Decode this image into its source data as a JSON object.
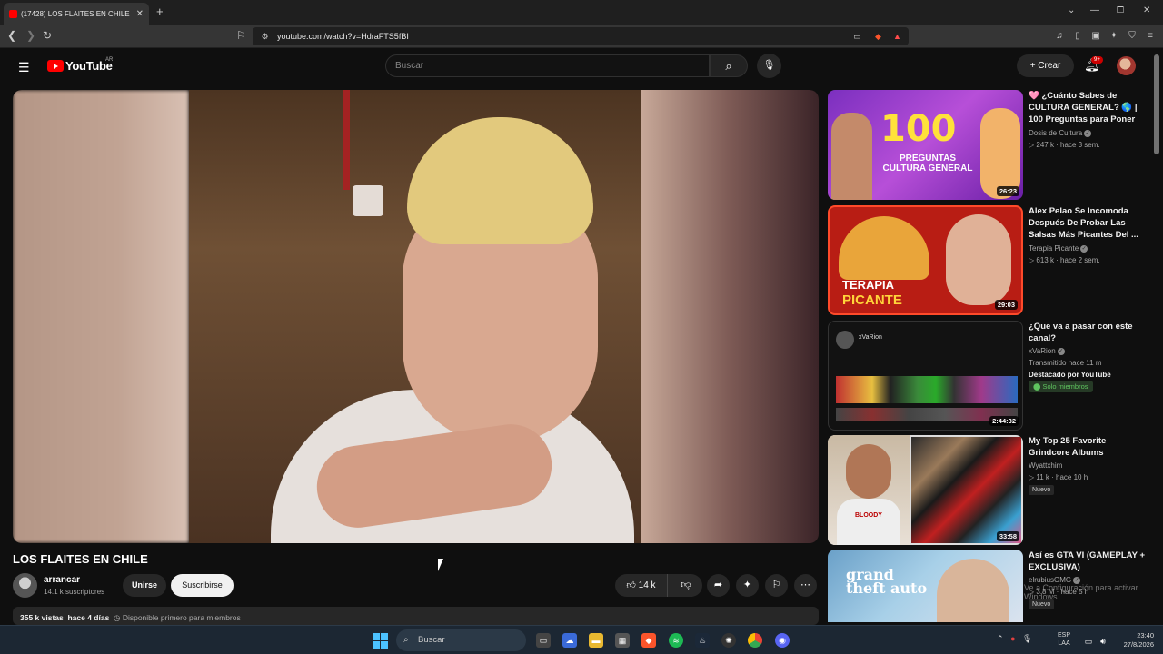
{
  "browser": {
    "tab_title": "(17428) LOS FLAITES EN CHILE",
    "tab_close": "✕",
    "new_tab": "+",
    "url": "youtube.com/watch?v=HdraFTS5fBI",
    "win_controls": [
      "⌄",
      "—",
      "⧠",
      "✕"
    ]
  },
  "header": {
    "logo_text": "YouTube",
    "country_code": "AR",
    "search_placeholder": "Buscar",
    "create_label": "+  Crear",
    "notif_badge": "9+"
  },
  "video": {
    "title": "LOS FLAITES EN CHILE",
    "channel": "arrancar",
    "subscribers": "14.1 k suscriptores",
    "join_label": "Unirse",
    "subscribe_label": "Suscribirse",
    "likes": "14 k",
    "views": "355 k vistas",
    "date": "hace 4 días",
    "members_note": "Disponible primero para miembros"
  },
  "recommendations": [
    {
      "title": "🩷 ¿Cuánto Sabes de CULTURA GENERAL? 🌎 | 100 Preguntas para Poner a...",
      "channel": "Dosis de Cultura",
      "meta": "▷ 247 k · hace 3 sem.",
      "duration": "26:23",
      "thumb_text": "100",
      "thumb_sub": "PREGUNTAS\nCULTURA GENERAL"
    },
    {
      "title": "Alex Pelao Se Incomoda Después De Probar Las Salsas Más Picantes Del ...",
      "channel": "Terapia Picante",
      "meta": "▷ 613 k · hace 2 sem.",
      "duration": "29:03",
      "thumb_text": "TERAPIA",
      "thumb_sub": "PICANTE"
    },
    {
      "title": "¿Que va a pasar con este canal?",
      "channel": "xVaRion",
      "meta": "Transmitido hace 11 m",
      "featured": "Destacado por YouTube",
      "members_badge": "Solo miembros",
      "duration": "2:44:32",
      "thumb_text": "xVaRion"
    },
    {
      "title": "My Top 25 Favorite Grindcore Albums",
      "channel": "Wyattxhim",
      "meta": "▷ 11 k · hace 10 h",
      "badge": "Nuevo",
      "duration": "33:58",
      "thumb_text": "BLOODY"
    },
    {
      "title": "Así es GTA VI (GAMEPLAY + EXCLUSIVA)",
      "channel": "elrubiusOMG",
      "meta": "▷ 3.8 M · hace 5 h",
      "badge": "Nuevo",
      "thumb_text": "grand theft auto"
    }
  ],
  "watermark": "Ve a Configuración para activar Windows.",
  "taskbar": {
    "search": "Buscar",
    "lang_top": "ESP",
    "lang_bottom": "LAA",
    "time": "23:40",
    "date": "27/8/2026"
  },
  "colors": {
    "bg": "#0f0f0f",
    "youtube_red": "#ff0000",
    "chip": "#272727"
  }
}
